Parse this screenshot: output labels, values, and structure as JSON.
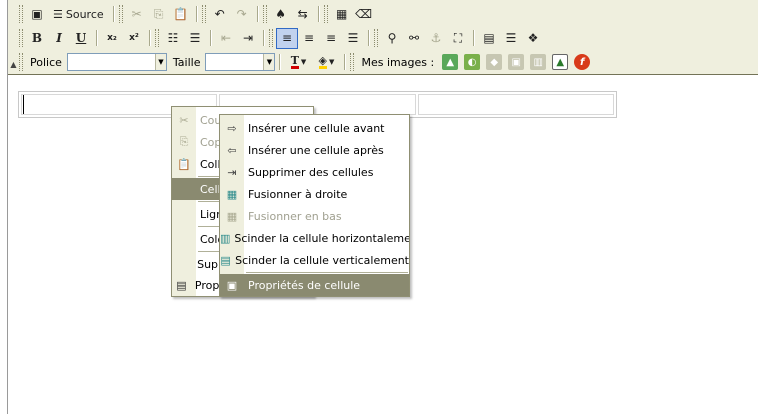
{
  "toolbar": {
    "source_label": "Source",
    "font_label": "Police",
    "size_label": "Taille",
    "font_value": "",
    "size_value": "",
    "images_label": "Mes images :"
  },
  "context_menu": {
    "items": [
      {
        "label": "Couper",
        "icon": "scissors-icon",
        "disabled": true
      },
      {
        "label": "Copier",
        "icon": "copy-icon",
        "disabled": true
      },
      {
        "label": "Coller",
        "icon": "paste-icon",
        "disabled": false
      },
      {
        "label": "Cellule",
        "icon": "",
        "disabled": false,
        "highlighted": true
      },
      {
        "label": "Ligne",
        "icon": "",
        "disabled": false
      },
      {
        "label": "Colonne",
        "icon": "",
        "disabled": false
      },
      {
        "label": "Supprimer le tableau",
        "icon": "",
        "disabled": false
      },
      {
        "label": "Propriétés du tableau",
        "icon": "table-icon",
        "disabled": false
      }
    ]
  },
  "cell_submenu": {
    "items": [
      {
        "label": "Insérer une cellule avant",
        "icon": "insert-cell-before-icon",
        "disabled": false
      },
      {
        "label": "Insérer une cellule après",
        "icon": "insert-cell-after-icon",
        "disabled": false
      },
      {
        "label": "Supprimer des cellules",
        "icon": "delete-cells-icon",
        "disabled": false
      },
      {
        "label": "Fusionner à droite",
        "icon": "merge-right-icon",
        "disabled": false
      },
      {
        "label": "Fusionner en bas",
        "icon": "merge-down-icon",
        "disabled": true
      },
      {
        "label": "Scinder la cellule horizontalement",
        "icon": "split-horizontal-icon",
        "disabled": false
      },
      {
        "label": "Scinder la cellule verticalement",
        "icon": "split-vertical-icon",
        "disabled": false
      },
      {
        "label": "Propriétés de cellule",
        "icon": "cell-properties-icon",
        "disabled": false,
        "highlighted": true
      }
    ]
  }
}
